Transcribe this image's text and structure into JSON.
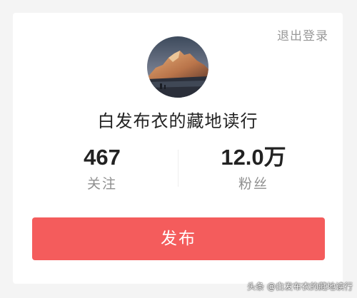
{
  "header": {
    "logout_label": "退出登录"
  },
  "profile": {
    "username": "白发布衣的藏地读行"
  },
  "stats": {
    "following": {
      "value": "467",
      "label": "关注"
    },
    "followers": {
      "value": "12.0万",
      "label": "粉丝"
    }
  },
  "actions": {
    "publish_label": "发布"
  },
  "watermark": {
    "text": "头条 @白发布衣的藏地读行"
  },
  "colors": {
    "accent": "#f45c5c",
    "background": "#f4f4f4",
    "card": "#ffffff"
  }
}
